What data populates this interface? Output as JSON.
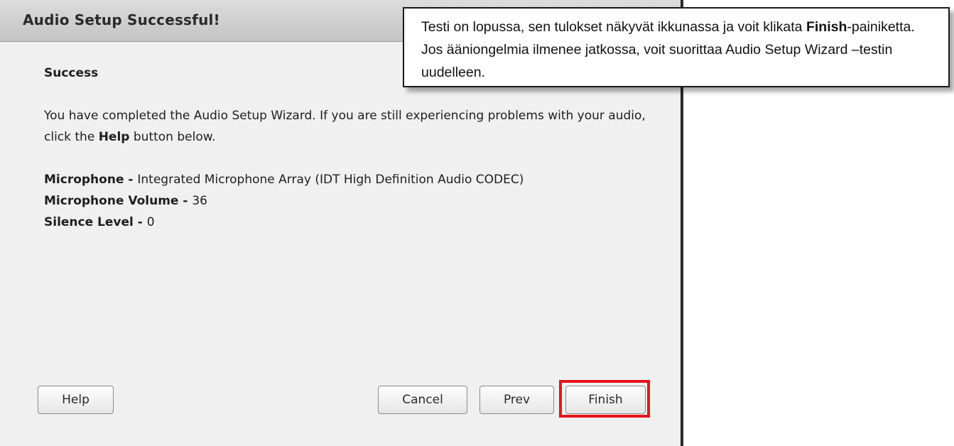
{
  "dialog": {
    "title": "Audio Setup Successful!",
    "heading": "Success",
    "message_part1": "You have completed the Audio Setup Wizard. If you are still experiencing problems with your audio, click the ",
    "message_bold": "Help",
    "message_part2": " button below.",
    "specs": [
      {
        "label": "Microphone - ",
        "value": "Integrated Microphone Array (IDT High Definition Audio CODEC)"
      },
      {
        "label": "Microphone Volume - ",
        "value": "36"
      },
      {
        "label": "Silence Level - ",
        "value": "0"
      }
    ],
    "buttons": {
      "help": "Help",
      "cancel": "Cancel",
      "prev": "Prev",
      "finish": "Finish"
    }
  },
  "callout": {
    "part1": "Testi on lopussa, sen tulokset näkyvät ikkunassa ja voit klikata ",
    "bold": "Finish",
    "part2": "-painiketta. Jos ääniongelmia ilmenee jatkossa, voit suorittaa Audio Setup Wizard –testin uudelleen."
  },
  "colors": {
    "highlight": "#e8141c",
    "dialog_bg": "#f0f0f0"
  }
}
